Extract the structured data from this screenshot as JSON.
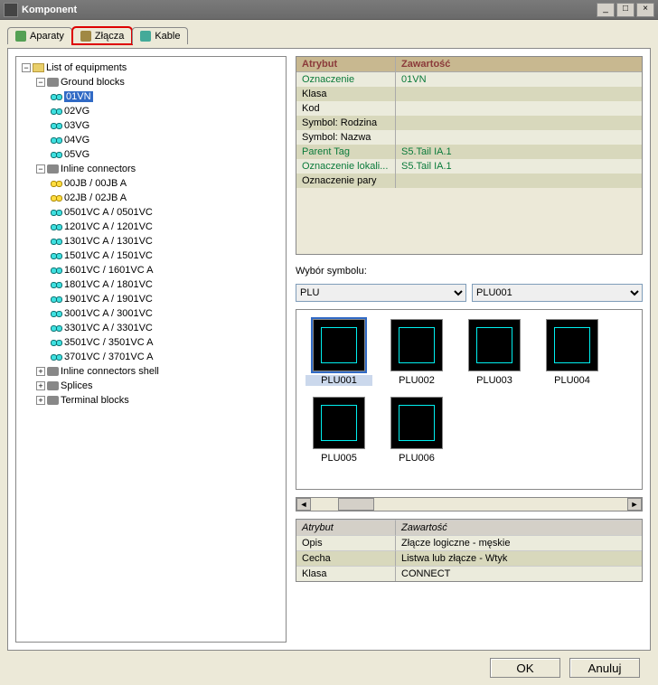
{
  "window": {
    "title": "Komponent",
    "minimize": "_",
    "maximize": "□",
    "close": "×"
  },
  "tabs": {
    "aparaty": "Aparaty",
    "zlacza": "Złącza",
    "kable": "Kable"
  },
  "tree": {
    "root": "List of equipments",
    "ground": "Ground blocks",
    "ground_items": [
      "01VN",
      "02VG",
      "03VG",
      "04VG",
      "05VG"
    ],
    "inline": "Inline connectors",
    "inline_items": [
      "00JB / 00JB    A",
      "02JB / 02JB    A",
      "0501VC    A / 0501VC",
      "1201VC    A / 1201VC",
      "1301VC    A / 1301VC",
      "1501VC    A / 1501VC",
      "1601VC / 1601VC    A",
      "1801VC    A / 1801VC",
      "1901VC    A / 1901VC",
      "3001VC    A / 3001VC",
      "3301VC    A / 3301VC",
      "3501VC / 3501VC    A",
      "3701VC / 3701VC    A"
    ],
    "inline_shell": "Inline connectors shell",
    "splices": "Splices",
    "terminal": "Terminal blocks"
  },
  "attr_header": {
    "c1": "Atrybut",
    "c2": "Zawartość"
  },
  "attr_rows": [
    {
      "c1": "Oznaczenie",
      "c2": "01VN",
      "green": true
    },
    {
      "c1": "Klasa",
      "c2": ""
    },
    {
      "c1": "Kod",
      "c2": ""
    },
    {
      "c1": "Symbol: Rodzina",
      "c2": ""
    },
    {
      "c1": "Symbol: Nazwa",
      "c2": ""
    },
    {
      "c1": "Parent Tag",
      "c2": "S5.Tail IA.1",
      "green": true
    },
    {
      "c1": "Oznaczenie lokali...",
      "c2": "S5.Tail IA.1",
      "green": true
    },
    {
      "c1": "Oznaczenie pary",
      "c2": ""
    }
  ],
  "symbol_label": "Wybór symbolu:",
  "select1": "PLU",
  "select2": "PLU001",
  "symbols": [
    "PLU001",
    "PLU002",
    "PLU003",
    "PLU004",
    "PLU005",
    "PLU006"
  ],
  "bottom_header": {
    "c1": "Atrybut",
    "c2": "Zawartość"
  },
  "bottom_rows": [
    {
      "c1": "Opis",
      "c2": "Złącze logiczne - męskie"
    },
    {
      "c1": "Cecha",
      "c2": "Listwa lub złącze - Wtyk"
    },
    {
      "c1": "Klasa",
      "c2": "CONNECT"
    }
  ],
  "buttons": {
    "ok": "OK",
    "cancel": "Anuluj"
  }
}
